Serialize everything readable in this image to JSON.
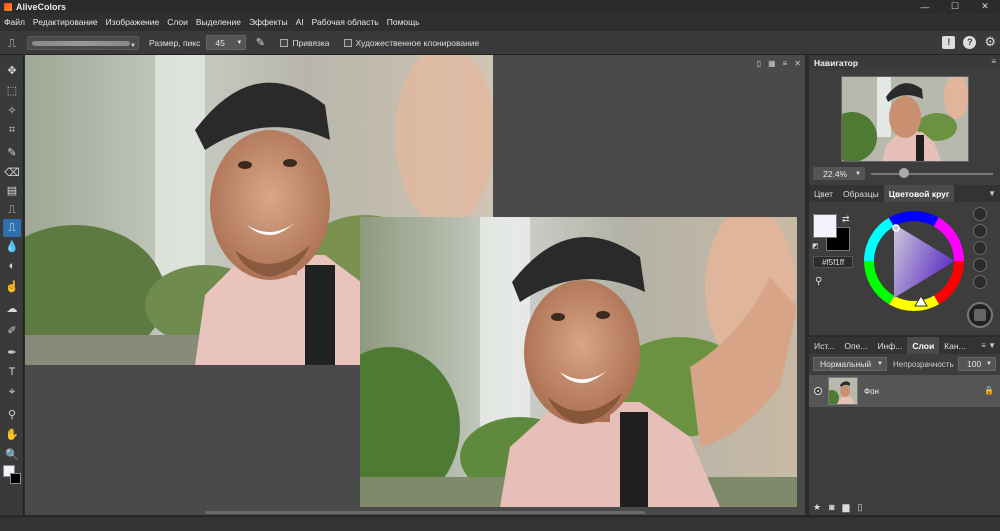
{
  "app": {
    "title": "AliveColors"
  },
  "window_controls": {
    "minimize": "—",
    "maximize": "☐",
    "close": "✕"
  },
  "menu": [
    "Файл",
    "Редактирование",
    "Изображение",
    "Слои",
    "Выделение",
    "Эффекты",
    "AI",
    "Рабочая область",
    "Помощь"
  ],
  "options": {
    "size_label": "Размер, пикс",
    "size_value": "45",
    "snap_label": "Привязка",
    "art_clone_label": "Художественное клонирование"
  },
  "help_icons": {
    "alert": "!",
    "help": "?",
    "settings": "⚙"
  },
  "navigator": {
    "title": "Навигатор",
    "zoom": "22.4%"
  },
  "color_panel": {
    "tabs": [
      "Цвет",
      "Образцы",
      "Цветовой круг"
    ],
    "active_tab": "Цветовой круг",
    "hex": "#f5f1ff",
    "fg_color": "#f5f1ff",
    "bg_color": "#000000"
  },
  "layers_panel": {
    "tabs": [
      "Ист...",
      "Опе...",
      "Инф...",
      "Слои",
      "Кан..."
    ],
    "active_tab": "Слои",
    "blend_mode": "Нормальный",
    "opacity_label": "Непрозрачность",
    "opacity_value": "100",
    "layers": [
      {
        "name": "Фон"
      }
    ]
  }
}
